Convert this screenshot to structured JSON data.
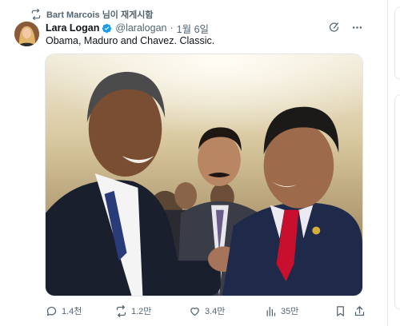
{
  "repost": {
    "label": "Bart Marcois 님이 재게시함",
    "icon": "repost-icon"
  },
  "author": {
    "name": "Lara Logan",
    "handle": "@laralogan",
    "separator": "·",
    "date": "1월 6일",
    "verified": true
  },
  "tweet": {
    "text": "Obama, Maduro and Chavez. Classic."
  },
  "photo": {
    "description_icon": "photo"
  },
  "actions": {
    "replies": "1.4천",
    "reposts": "1.2만",
    "likes": "3.4만",
    "views": "35만"
  },
  "colors": {
    "muted": "#536471",
    "verified": "#1d9bf0",
    "text": "#0f1419"
  }
}
